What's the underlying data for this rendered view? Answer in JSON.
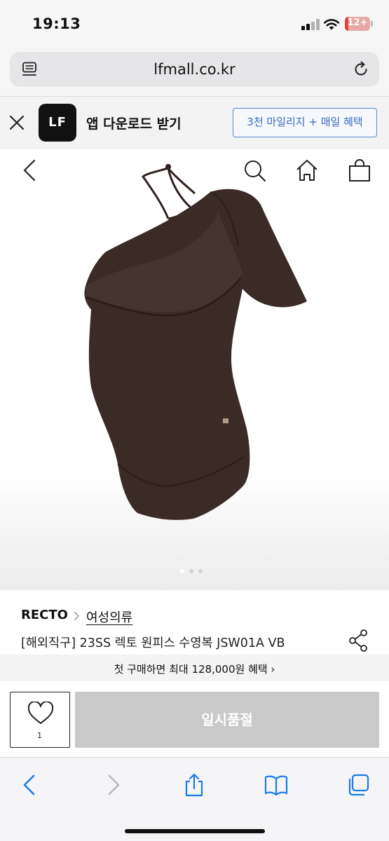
{
  "status_bar": {
    "time": "19:13",
    "battery": "12+",
    "battery_level": 0.12
  },
  "browser": {
    "url": "lfmall.co.kr"
  },
  "app_banner": {
    "logo": "LF",
    "title": "앱 다운로드 받기",
    "button": "3천 마일리지 + 매일 혜택"
  },
  "gallery": {
    "image_count": 3,
    "active_index": 0
  },
  "product": {
    "brand": "RECTO",
    "category": "여성의류",
    "name": "[해외직구] 23SS 렉토 원피스 수영복 JSW01A VB"
  },
  "benefit": {
    "text": "첫 구매하면 최대 128,000원 혜택 ›"
  },
  "purchase": {
    "like_count": "1",
    "soldout_label": "일시품절"
  },
  "colors": {
    "accent_blue": "#3a6cbf",
    "soldout_gray": "#c9c9c9",
    "safari_blue": "#1a7ce9",
    "swimsuit": "#3a2b27"
  }
}
